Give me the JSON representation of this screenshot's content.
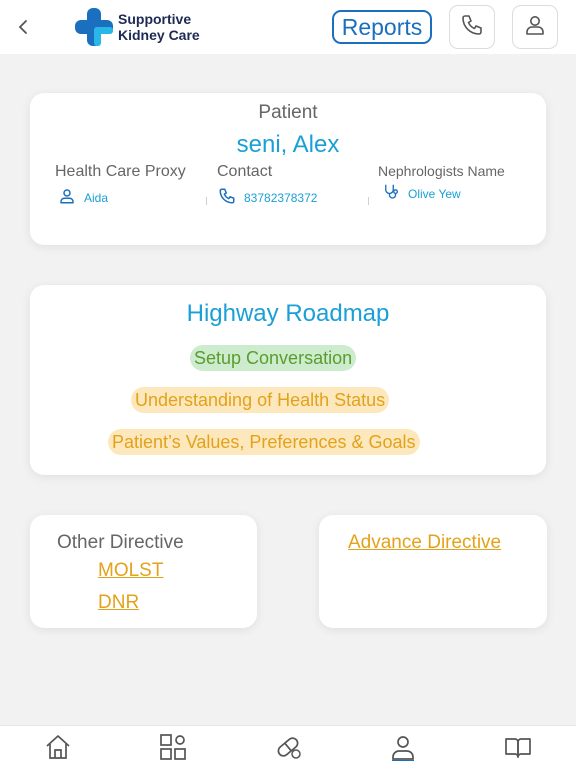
{
  "header": {
    "brand_line1": "Supportive",
    "brand_line2": "Kidney Care",
    "reports_label": "Reports",
    "icons": [
      "back-chevron-icon",
      "phone-icon",
      "user-icon"
    ]
  },
  "patient": {
    "label": "Patient",
    "name": "seni, Alex",
    "proxy_label": "Health Care Proxy",
    "proxy_value": "Aida",
    "contact_label": "Contact",
    "contact_value": "83782378372",
    "nephrologist_label": "Nephrologists Name",
    "nephrologist_value": "Olive Yew"
  },
  "roadmap": {
    "title": "Highway Roadmap",
    "steps": [
      {
        "label": "Setup Conversation",
        "status": "green"
      },
      {
        "label": "Understanding of Health Status",
        "status": "orange"
      },
      {
        "label": "Patient’s Values, Preferences & Goals",
        "status": "orange"
      }
    ]
  },
  "directives": {
    "other_title": "Other Directive",
    "molst": "MOLST",
    "dnr": "DNR",
    "advance": "Advance Directive"
  },
  "bottom_nav": [
    "home-icon",
    "apps-grid-icon",
    "medication-icon",
    "profile-icon",
    "book-icon"
  ],
  "colors": {
    "accent_blue": "#1aa0d6",
    "reports_blue": "#1b6fbf",
    "green": "#5a9c2e",
    "green_bg": "#cdeccd",
    "orange": "#e3a21a",
    "orange_bg": "#fde7bd",
    "active_nav": "#1b6fbf"
  }
}
